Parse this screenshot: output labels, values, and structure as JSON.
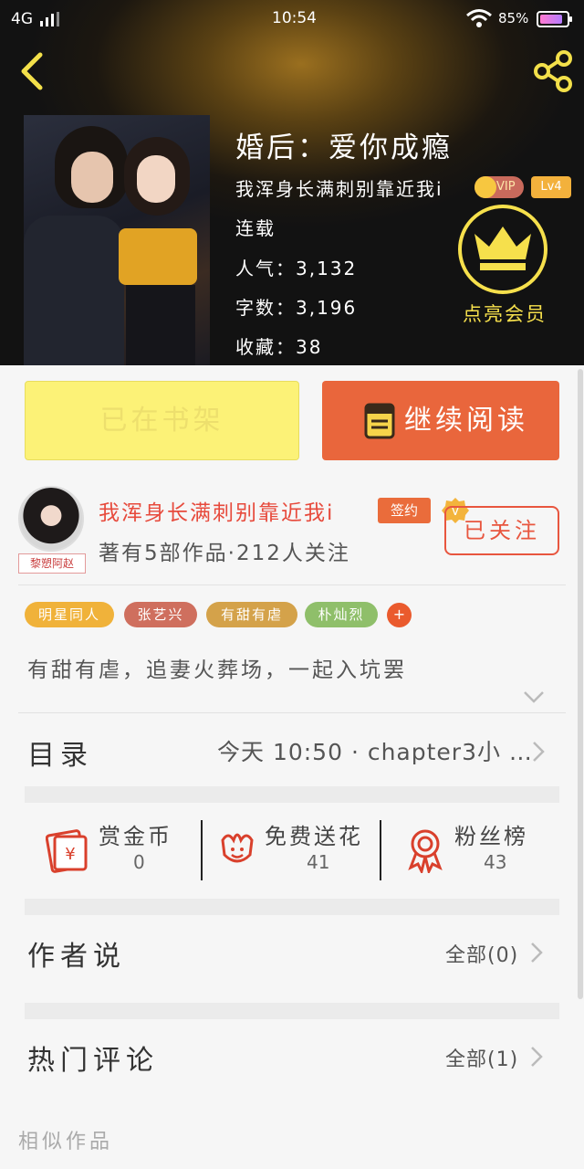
{
  "status_bar": {
    "network": "4G",
    "time": "10:54",
    "battery": "85%",
    "battery_level": 0.85
  },
  "book": {
    "title": "婚后：爱你成瘾",
    "author": "我浑身长满刺别靠近我i",
    "vip": "VIP",
    "level": "Lv4",
    "status": "连载",
    "popularity": "人气：3,132",
    "word_count": "字数：3,196",
    "collections": "收藏：38"
  },
  "member": {
    "label": "点亮会员"
  },
  "actions": {
    "shelf": "已在书架",
    "read": "继续阅读"
  },
  "author": {
    "name": "我浑身长满刺别靠近我i",
    "avatar_caption": "黎愬阿赵",
    "signed": "签约",
    "stats": "著有5部作品·212人关注",
    "follow": "已关注"
  },
  "tags": [
    {
      "label": "明星同人",
      "color": "#f0b23a"
    },
    {
      "label": "张艺兴",
      "color": "#cf6f5e"
    },
    {
      "label": "有甜有虐",
      "color": "#d4a24a"
    },
    {
      "label": "朴灿烈",
      "color": "#8fbf6a"
    }
  ],
  "tag_more": "+",
  "description": "有甜有虐，追妻火葬场，一起入坑罢",
  "catalog": {
    "label": "目录",
    "latest": "今天 10:50 · chapter3小 …"
  },
  "stats": [
    {
      "label": "赏金币",
      "value": "0",
      "icon": "red-envelope-icon"
    },
    {
      "label": "免费送花",
      "value": "41",
      "icon": "flower-icon"
    },
    {
      "label": "粉丝榜",
      "value": "43",
      "icon": "medal-icon"
    }
  ],
  "author_says": {
    "label": "作者说",
    "all": "全部(0)"
  },
  "hot_comments": {
    "label": "热门评论",
    "all": "全部(1)"
  },
  "similar": {
    "label": "相似作品"
  },
  "colors": {
    "accent": "#e9663c",
    "shelf_bg": "#fcf277",
    "member": "#f6e04c"
  }
}
